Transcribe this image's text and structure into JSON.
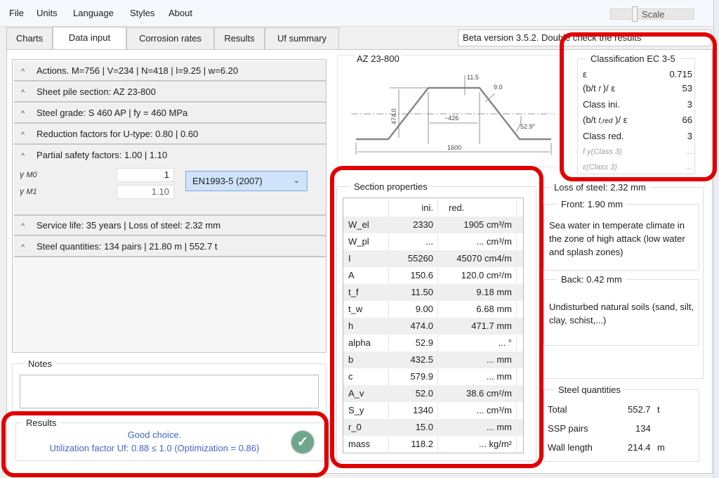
{
  "menu": [
    "File",
    "Units",
    "Language",
    "Styles",
    "About"
  ],
  "scale_label": "Scale",
  "tabs": [
    "Charts",
    "Data input",
    "Corrosion rates",
    "Results",
    "Uf summary"
  ],
  "active_tab": "Data input",
  "beta_notice": "Beta version 3.5.2. Double check the results",
  "expanders": {
    "actions": "Actions. M=756 | V=234 | N=418 | l=9.25 | w=6.20",
    "section": "Sheet pile section:  AZ 23-800",
    "steel_grade": "Steel grade: S 460 AP | fy = 460 MPa",
    "reduction": "Reduction factors for U-type: 0.80 | 0.60",
    "partial": "Partial safety factors: 1.00 | 1.10",
    "service": "Service life: 35 years | Loss of steel: 2.32 mm",
    "quantities": "Steel quantities: 134 pairs | 21.80 m | 552.7 t"
  },
  "partial_safety": {
    "gamma_m0_label": "γ",
    "gamma_m0_sub": "M0",
    "gamma_m0_value": "1",
    "gamma_m1_label": "γ",
    "gamma_m1_sub": "M1",
    "gamma_m1_value": "1.10",
    "standard_selected": "EN1993-5 (2007)"
  },
  "notes": {
    "label": "Notes",
    "value": ""
  },
  "results": {
    "label": "Results",
    "line1": "Good choice.",
    "line2": "Utilization factor Uf: 0.88 ≤ 1.0 (Optimization =  0.86)",
    "status_icon": "check-icon",
    "status_color": "#6fa78e",
    "text_color": "#4466c8"
  },
  "section_drawing": {
    "title": "AZ 23-800",
    "dims": {
      "flange_t": "11.5",
      "web_t": "9.0",
      "height": "474.0",
      "flange_w": "~426",
      "angle": "52.9°",
      "width": "1600"
    }
  },
  "section_properties": {
    "label": "Section properties",
    "headers": [
      "",
      "ini.",
      "red."
    ],
    "rows": [
      [
        "W_el",
        "2330",
        "1905 cm³/m"
      ],
      [
        "W_pl",
        "...",
        "... cm³/m"
      ],
      [
        "I",
        "55260",
        "45070 cm4/m"
      ],
      [
        "A",
        "150.6",
        "120.0 cm²/m"
      ],
      [
        "t_f",
        "11.50",
        "9.18 mm"
      ],
      [
        "t_w",
        "9.00",
        "6.68 mm"
      ],
      [
        "h",
        "474.0",
        "471.7 mm"
      ],
      [
        "alpha",
        "52.9",
        "... °"
      ],
      [
        "b",
        "432.5",
        "... mm"
      ],
      [
        "c",
        "579.9",
        "... mm"
      ],
      [
        "A_v",
        "52.0",
        "38.6 cm²/m"
      ],
      [
        "S_y",
        "1340",
        "... cm³/m"
      ],
      [
        "r_0",
        "15.0",
        "... mm"
      ],
      [
        "mass",
        "118.2",
        "... kg/m²"
      ]
    ]
  },
  "classification": {
    "label": "Classification EC 3-5",
    "rows": [
      {
        "label": "ε",
        "value": "0.715"
      },
      {
        "label": "(b/t f )/ ε",
        "value": "53"
      },
      {
        "label": "Class ini.",
        "value": "3"
      },
      {
        "label": "(b/t f,red )/ ε",
        "value": "66"
      },
      {
        "label": "Class red.",
        "value": "3"
      },
      {
        "label": "f y(Class 3)",
        "value": "..."
      },
      {
        "label": "ε(Class 3)",
        "value": "..."
      }
    ]
  },
  "loss_of_steel": {
    "label": "Loss of steel:  2.32 mm",
    "front_label": "Front:  1.90 mm",
    "front_desc": "Sea water in temperate climate in the zone of high attack (low water and splash zones)",
    "back_label": "Back:  0.42 mm",
    "back_desc": "Undisturbed natural soils (sand, silt, clay, schist,...)"
  },
  "steel_quantities": {
    "label": "Steel quantities",
    "rows": [
      {
        "label": "Total",
        "value": "552.7",
        "unit": "t"
      },
      {
        "label": "SSP pairs",
        "value": "134",
        "unit": ""
      },
      {
        "label": "Wall length",
        "value": "214.4",
        "unit": "m"
      }
    ]
  },
  "highlight_color": "#e10000"
}
